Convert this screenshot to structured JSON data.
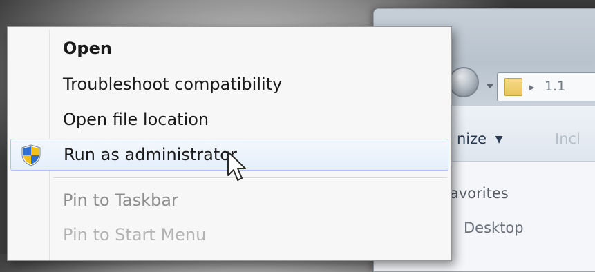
{
  "explorer": {
    "breadcrumb": "1.1",
    "toolbar": {
      "organize": "nize",
      "include": "Incl"
    },
    "navpane": {
      "favorites": "avorites",
      "desktop": "Desktop"
    }
  },
  "context_menu": {
    "items": [
      {
        "label": "Open",
        "style": "bold"
      },
      {
        "label": "Troubleshoot compatibility"
      },
      {
        "label": "Open file location"
      },
      {
        "label": "Run as administrator",
        "icon": "uac-shield-icon",
        "state": "hover"
      },
      {
        "label": "Pin to Taskbar"
      },
      {
        "label": "Pin to Start Menu"
      }
    ]
  },
  "colors": {
    "menu_background": "#f7f7f7",
    "hover_border": "#a9c6eb",
    "hover_fill": "#e4eefb",
    "shield_blue": "#2f6fd0",
    "shield_yellow": "#f3c21a"
  }
}
